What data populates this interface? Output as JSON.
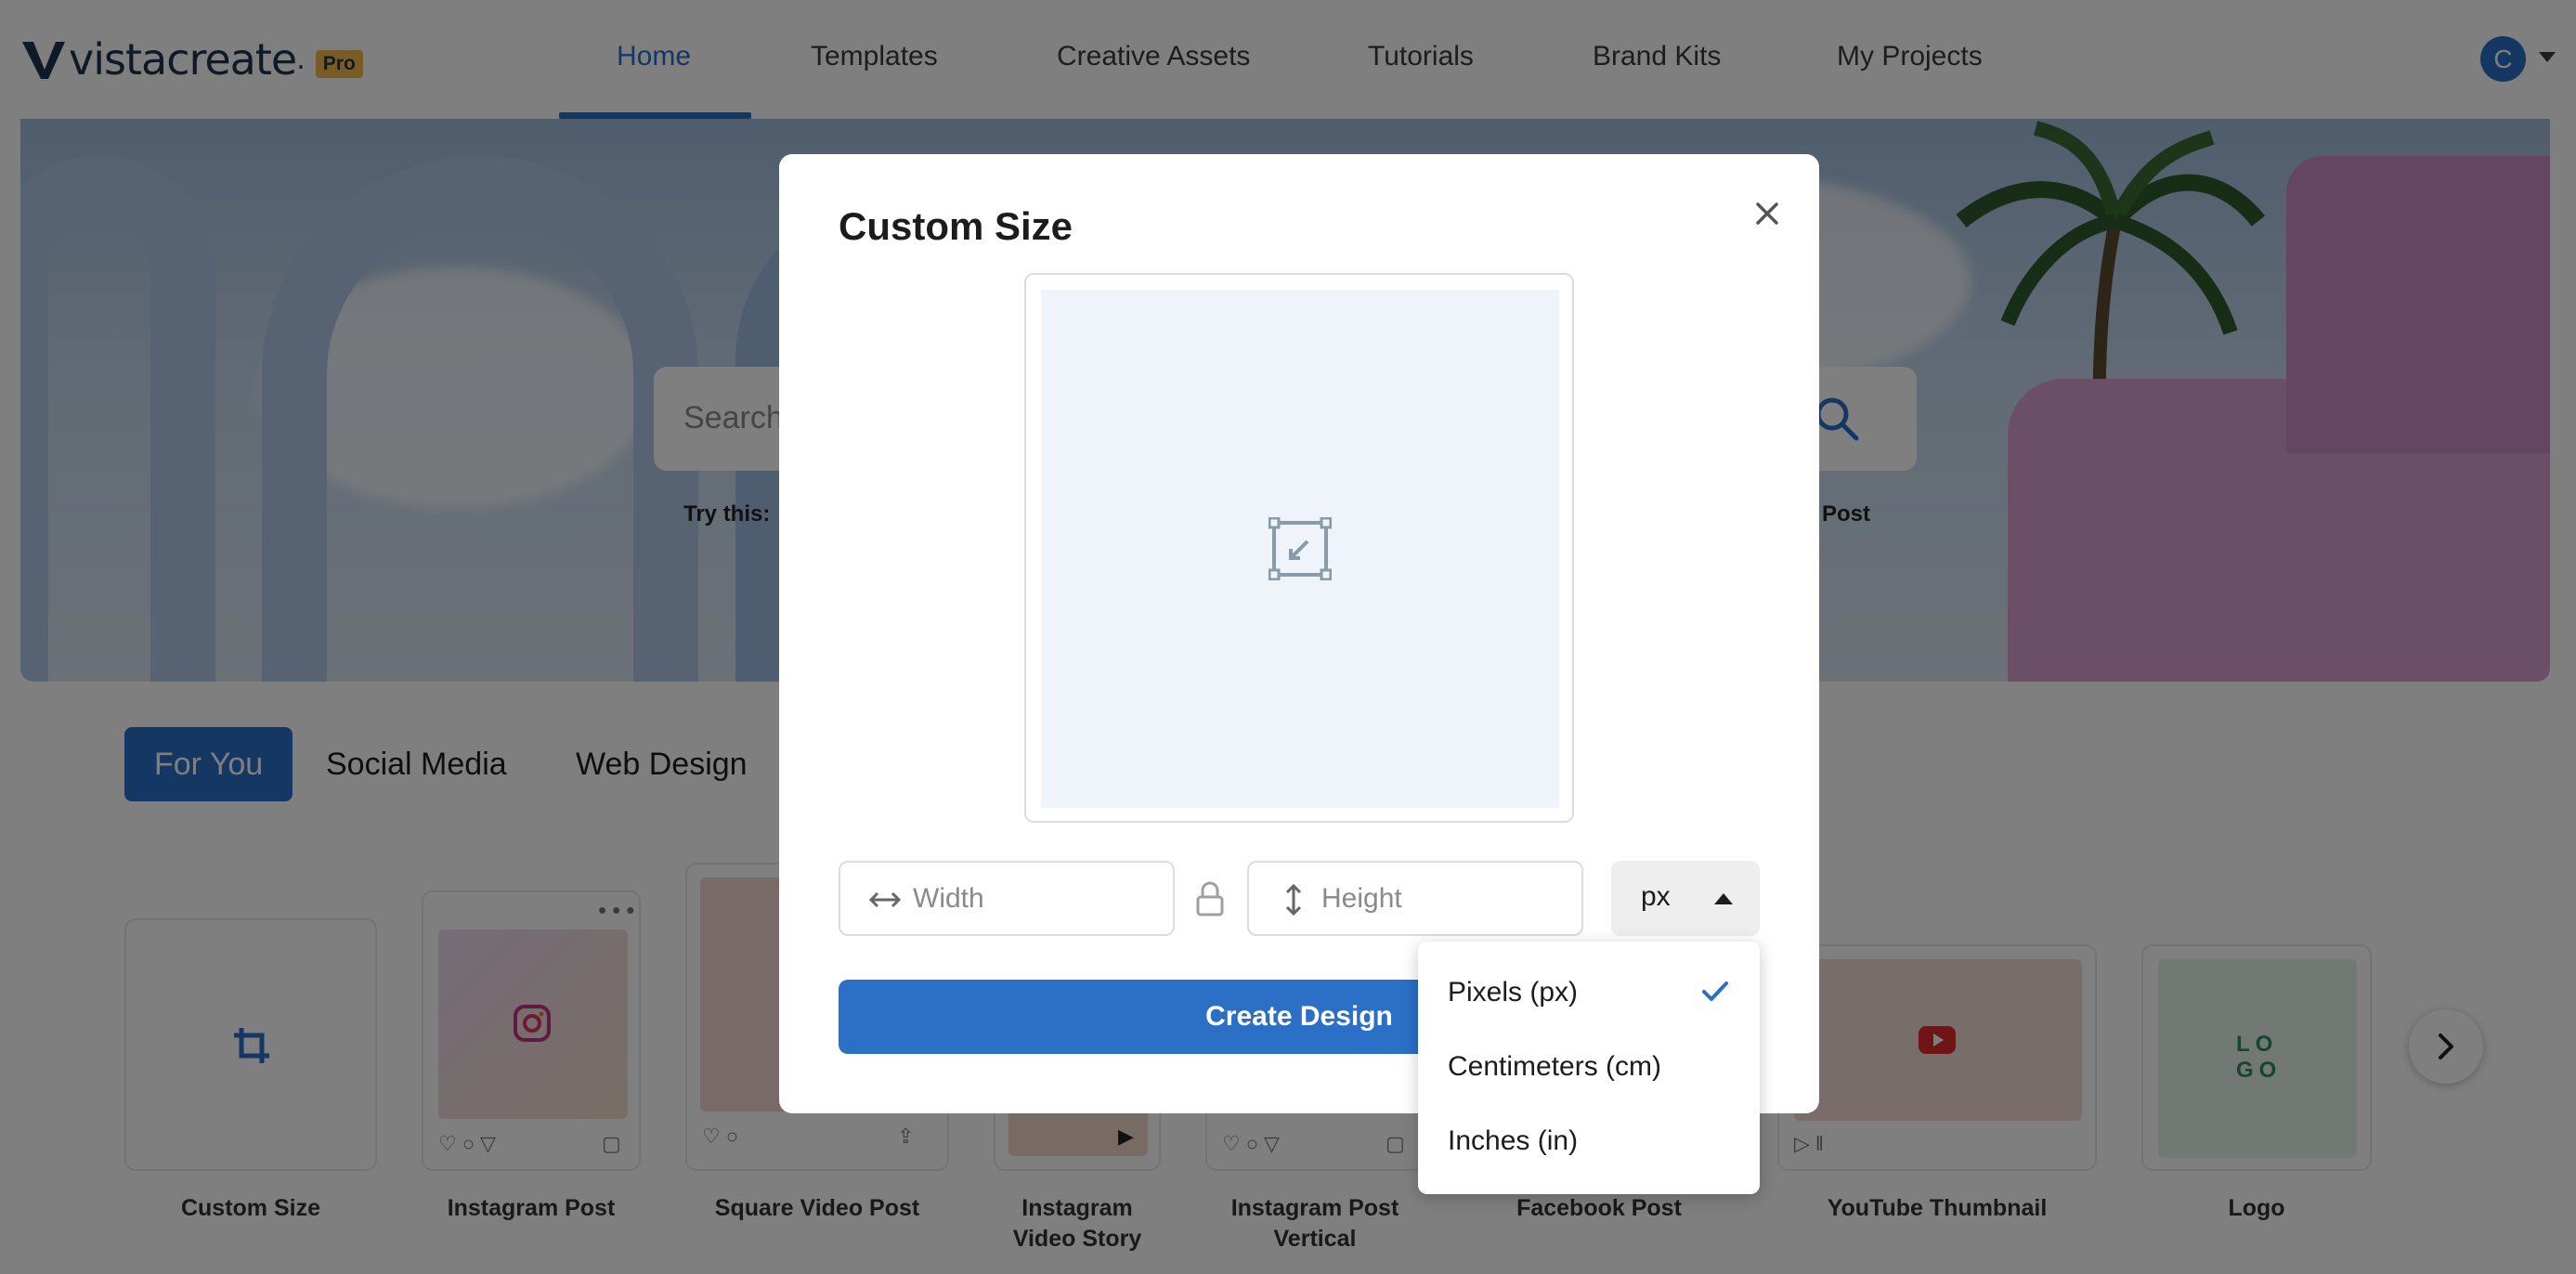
{
  "brand": {
    "name": "vistacreate",
    "trademark": ".",
    "badge": "Pro",
    "accent_color": "#2b6fc6"
  },
  "nav": {
    "items": [
      {
        "label": "Home",
        "active": true
      },
      {
        "label": "Templates",
        "active": false
      },
      {
        "label": "Creative Assets",
        "active": false
      },
      {
        "label": "Tutorials",
        "active": false
      },
      {
        "label": "Brand Kits",
        "active": false
      },
      {
        "label": "My Projects",
        "active": false
      }
    ]
  },
  "user": {
    "avatar_initial": "C",
    "menu_icon": "chevron-down-icon"
  },
  "hero": {
    "search_placeholder": "Search",
    "search_icon": "search-icon",
    "try_label": "Try this:",
    "try_suggestion_visible": "m Post"
  },
  "categories": {
    "tabs": [
      {
        "label": "For You",
        "active": true
      },
      {
        "label": "Social Media",
        "active": false
      },
      {
        "label": "Web Design",
        "active": false
      }
    ]
  },
  "templates": {
    "items": [
      {
        "label": "Custom Size",
        "icon": "crop-icon"
      },
      {
        "label": "Instagram Post",
        "icon": "instagram-icon"
      },
      {
        "label": "Square Video Post",
        "icon": "video-icon"
      },
      {
        "label_line1": "Instagram",
        "label_line2": "Video Story",
        "icon": "play-icon"
      },
      {
        "label_line1": "Instagram Post",
        "label_line2": "Vertical",
        "icon": "heart-icon"
      },
      {
        "label": "Facebook Post",
        "icon": "facebook-icon"
      },
      {
        "label": "YouTube Thumbnail",
        "icon": "youtube-icon"
      },
      {
        "label": "Logo",
        "logo_text_1": "LO",
        "logo_text_2": "GO"
      }
    ],
    "next_icon": "chevron-right-icon"
  },
  "modal": {
    "title": "Custom Size",
    "close_icon": "close-icon",
    "preview_icon": "resize-icon",
    "width_placeholder": "Width",
    "height_placeholder": "Height",
    "lock_icon": "lock-icon",
    "unit_value": "px",
    "create_button": "Create Design"
  },
  "unit_dropdown": {
    "options": [
      {
        "label": "Pixels (px)",
        "selected": true
      },
      {
        "label": "Centimeters (cm)",
        "selected": false
      },
      {
        "label": "Inches (in)",
        "selected": false
      }
    ],
    "check_icon": "check-icon"
  }
}
